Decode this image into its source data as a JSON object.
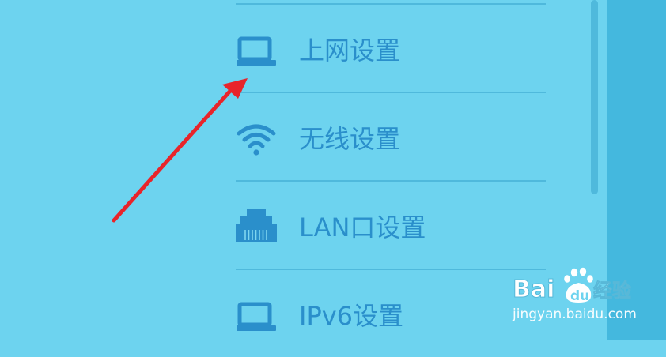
{
  "menu": {
    "items": [
      {
        "id": "internet",
        "icon": "laptop-icon",
        "label": "上网设置"
      },
      {
        "id": "wireless",
        "icon": "wifi-icon",
        "label": "无线设置"
      },
      {
        "id": "lan",
        "icon": "ethernet-port-icon",
        "label": "LAN口设置"
      },
      {
        "id": "ipv6",
        "icon": "laptop-icon",
        "label": "IPv6设置"
      }
    ]
  },
  "watermark": {
    "brand_logo": "Bai du 经验",
    "domain": "jingyan.baidu.com"
  },
  "colors": {
    "background": "#6dd3ef",
    "text": "#2a8fcb",
    "divider": "#4fb9dc",
    "side_panel": "#44b8de",
    "annotation_arrow": "#e8242a"
  }
}
